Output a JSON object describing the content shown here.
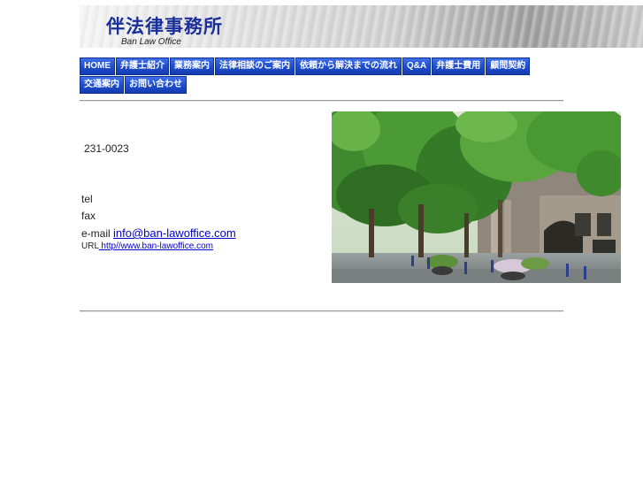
{
  "header": {
    "title": "伴法律事務所",
    "subtitle": "Ban Law Office"
  },
  "nav": {
    "items": [
      {
        "label": "HOME"
      },
      {
        "label": "弁護士紹介"
      },
      {
        "label": "業務案内"
      },
      {
        "label": "法律相談のご案内"
      },
      {
        "label": "依頼から解決までの流れ"
      },
      {
        "label": "Q&A"
      },
      {
        "label": "弁護士費用"
      },
      {
        "label": "顧問契約"
      },
      {
        "label": "交通案内"
      },
      {
        "label": "お問い合わせ"
      }
    ]
  },
  "contact": {
    "postal": "231-0023",
    "tel_label": "tel",
    "fax_label": "fax",
    "email_label": "e-mail",
    "email": "info@ban-lawoffice.com",
    "url_label": "URL",
    "url": " http//www.ban-lawoffice.com"
  },
  "colors": {
    "title_blue": "#1a2f9a",
    "nav_blue": "#1e4fcf",
    "link": "#0000cc"
  }
}
